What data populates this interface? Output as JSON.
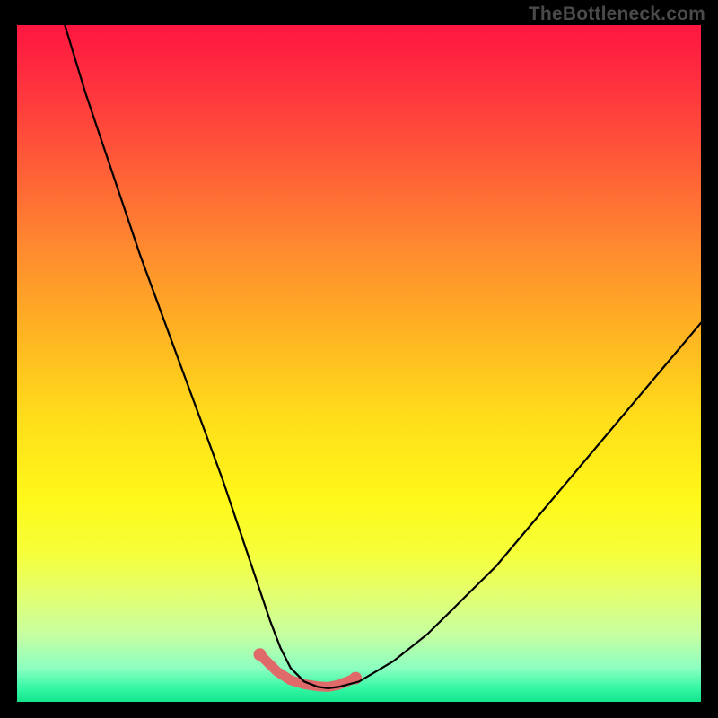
{
  "watermark": "TheBottleneck.com",
  "chart_data": {
    "type": "line",
    "title": "",
    "xlabel": "",
    "ylabel": "",
    "xlim": [
      0,
      100
    ],
    "ylim": [
      0,
      100
    ],
    "grid": false,
    "legend": false,
    "annotations": [],
    "series": [
      {
        "name": "curve",
        "x": [
          7,
          10,
          14,
          18,
          22,
          26,
          30,
          33,
          35,
          37,
          38.5,
          40,
          42,
          44,
          45.5,
          47,
          50,
          55,
          60,
          65,
          70,
          75,
          80,
          85,
          90,
          95,
          100
        ],
        "y": [
          100,
          90,
          78,
          66,
          55,
          44,
          33,
          24,
          18,
          12,
          8,
          5,
          3,
          2.2,
          2,
          2.2,
          3,
          6,
          10,
          15,
          20,
          26,
          32,
          38,
          44,
          50,
          56
        ]
      }
    ],
    "highlight": {
      "x": [
        35.5,
        38,
        40,
        42,
        44,
        45.5,
        47,
        49.5
      ],
      "y": [
        7,
        4.5,
        3.2,
        2.6,
        2.3,
        2.2,
        2.5,
        3.5
      ]
    },
    "colors": {
      "curve": "#000000",
      "highlight": "#e06a6a",
      "gradient_top": "#ff163f",
      "gradient_bottom": "#14e58b"
    }
  }
}
